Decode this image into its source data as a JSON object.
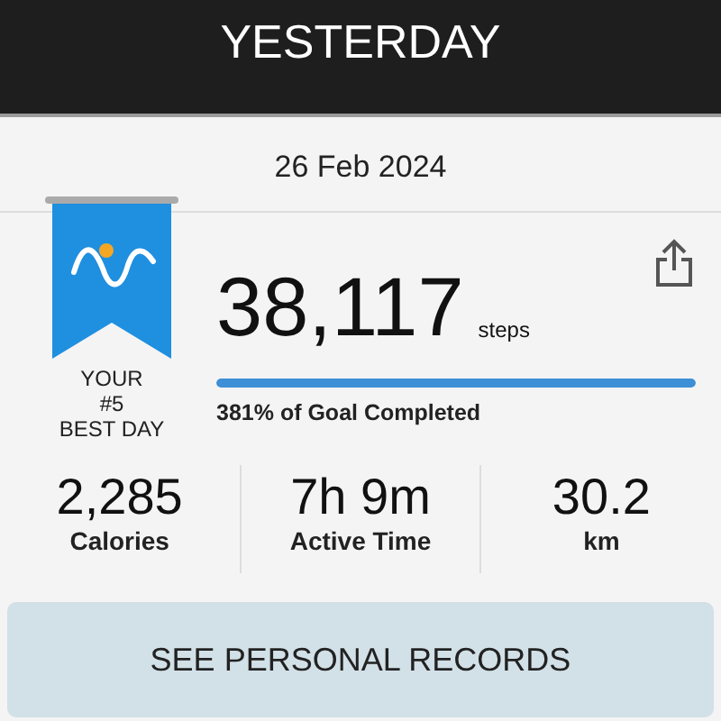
{
  "header": {
    "title": "YESTERDAY"
  },
  "date": "26 Feb 2024",
  "rank": {
    "line1": "YOUR",
    "line2": "#5",
    "line3": "BEST DAY"
  },
  "steps": {
    "value": "38,117",
    "unit": "steps",
    "level": 1,
    "goal_text": "381% of Goal Completed"
  },
  "stats": [
    {
      "value": "2,285",
      "label": "Calories"
    },
    {
      "value": "7h 9m",
      "label": "Active Time"
    },
    {
      "value": "30.2",
      "label": "km"
    }
  ],
  "button": "SEE PERSONAL RECORDS"
}
